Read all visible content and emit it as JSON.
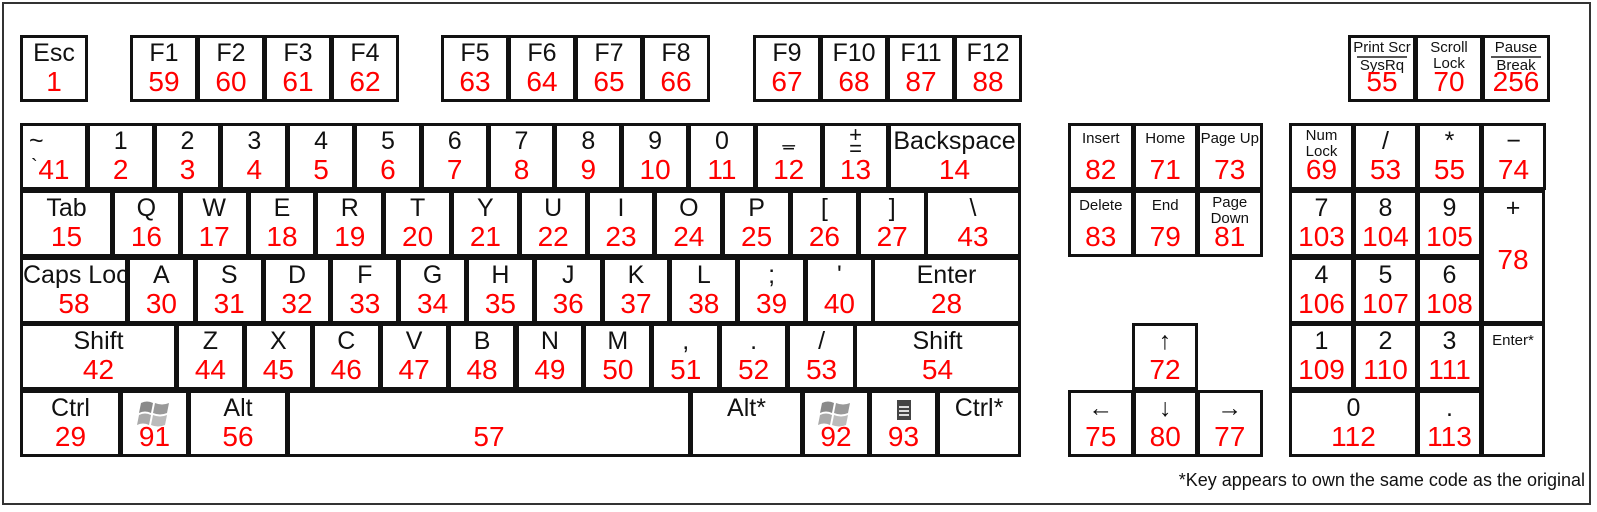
{
  "keys": [
    {
      "id": "esc",
      "label": "Esc",
      "code": "1"
    },
    {
      "id": "f1",
      "label": "F1",
      "code": "59"
    },
    {
      "id": "f2",
      "label": "F2",
      "code": "60"
    },
    {
      "id": "f3",
      "label": "F3",
      "code": "61"
    },
    {
      "id": "f4",
      "label": "F4",
      "code": "62"
    },
    {
      "id": "f5",
      "label": "F5",
      "code": "63"
    },
    {
      "id": "f6",
      "label": "F6",
      "code": "64"
    },
    {
      "id": "f7",
      "label": "F7",
      "code": "65"
    },
    {
      "id": "f8",
      "label": "F8",
      "code": "66"
    },
    {
      "id": "f9",
      "label": "F9",
      "code": "67"
    },
    {
      "id": "f10",
      "label": "F10",
      "code": "68"
    },
    {
      "id": "f11",
      "label": "F11",
      "code": "87"
    },
    {
      "id": "f12",
      "label": "F12",
      "code": "88"
    },
    {
      "id": "printscr",
      "label": "Print Scr",
      "label2": "SysRq",
      "code": "55"
    },
    {
      "id": "scrolllock",
      "label": "Scroll",
      "label2": "Lock",
      "code": "70"
    },
    {
      "id": "pause",
      "label": "Pause",
      "label2": "Break",
      "code": "256"
    },
    {
      "id": "tilde",
      "label": "~",
      "label2": "`",
      "code": "41"
    },
    {
      "id": "1",
      "label": "1",
      "code": "2"
    },
    {
      "id": "2",
      "label": "2",
      "code": "3"
    },
    {
      "id": "3",
      "label": "3",
      "code": "4"
    },
    {
      "id": "4",
      "label": "4",
      "code": "5"
    },
    {
      "id": "5",
      "label": "5",
      "code": "6"
    },
    {
      "id": "6",
      "label": "6",
      "code": "7"
    },
    {
      "id": "7",
      "label": "7",
      "code": "8"
    },
    {
      "id": "8",
      "label": "8",
      "code": "9"
    },
    {
      "id": "9",
      "label": "9",
      "code": "10"
    },
    {
      "id": "0",
      "label": "0",
      "code": "11"
    },
    {
      "id": "minus",
      "label": "_",
      "label2": "−",
      "code": "12"
    },
    {
      "id": "equals",
      "label": "+",
      "label2": "=",
      "code": "13"
    },
    {
      "id": "backspace",
      "label": "Backspace",
      "code": "14"
    },
    {
      "id": "tab",
      "label": "Tab",
      "code": "15"
    },
    {
      "id": "q",
      "label": "Q",
      "code": "16"
    },
    {
      "id": "w",
      "label": "W",
      "code": "17"
    },
    {
      "id": "e",
      "label": "E",
      "code": "18"
    },
    {
      "id": "r",
      "label": "R",
      "code": "19"
    },
    {
      "id": "t",
      "label": "T",
      "code": "20"
    },
    {
      "id": "y",
      "label": "Y",
      "code": "21"
    },
    {
      "id": "u",
      "label": "U",
      "code": "22"
    },
    {
      "id": "i",
      "label": "I",
      "code": "23"
    },
    {
      "id": "o",
      "label": "O",
      "code": "24"
    },
    {
      "id": "p",
      "label": "P",
      "code": "25"
    },
    {
      "id": "lbracket",
      "label": "[",
      "code": "26"
    },
    {
      "id": "rbracket",
      "label": "]",
      "code": "27"
    },
    {
      "id": "backslash",
      "label": "\\",
      "code": "43"
    },
    {
      "id": "capslock",
      "label": "Caps Lock",
      "code": "58"
    },
    {
      "id": "a",
      "label": "A",
      "code": "30"
    },
    {
      "id": "s",
      "label": "S",
      "code": "31"
    },
    {
      "id": "d",
      "label": "D",
      "code": "32"
    },
    {
      "id": "f",
      "label": "F",
      "code": "33"
    },
    {
      "id": "g",
      "label": "G",
      "code": "34"
    },
    {
      "id": "h",
      "label": "H",
      "code": "35"
    },
    {
      "id": "j",
      "label": "J",
      "code": "36"
    },
    {
      "id": "k",
      "label": "K",
      "code": "37"
    },
    {
      "id": "l",
      "label": "L",
      "code": "38"
    },
    {
      "id": "semicolon",
      "label": ";",
      "code": "39"
    },
    {
      "id": "quote",
      "label": "'",
      "code": "40"
    },
    {
      "id": "enter",
      "label": "Enter",
      "code": "28"
    },
    {
      "id": "lshift",
      "label": "Shift",
      "code": "42"
    },
    {
      "id": "z",
      "label": "Z",
      "code": "44"
    },
    {
      "id": "x",
      "label": "X",
      "code": "45"
    },
    {
      "id": "c",
      "label": "C",
      "code": "46"
    },
    {
      "id": "v",
      "label": "V",
      "code": "47"
    },
    {
      "id": "b",
      "label": "B",
      "code": "48"
    },
    {
      "id": "n",
      "label": "N",
      "code": "49"
    },
    {
      "id": "m",
      "label": "M",
      "code": "50"
    },
    {
      "id": "comma",
      "label": ",",
      "code": "51"
    },
    {
      "id": "period",
      "label": ".",
      "code": "52"
    },
    {
      "id": "slash",
      "label": "/",
      "code": "53"
    },
    {
      "id": "rshift",
      "label": "Shift",
      "code": "54"
    },
    {
      "id": "lctrl",
      "label": "Ctrl",
      "code": "29"
    },
    {
      "id": "lwin",
      "icon": "windows-logo-icon",
      "code": "91"
    },
    {
      "id": "lalt",
      "label": "Alt",
      "code": "56"
    },
    {
      "id": "space",
      "code": "57"
    },
    {
      "id": "ralt",
      "label": "Alt*"
    },
    {
      "id": "rwin",
      "icon": "windows-logo-icon",
      "code": "92"
    },
    {
      "id": "menu",
      "icon": "menu-key-icon",
      "code": "93"
    },
    {
      "id": "rctrl",
      "label": "Ctrl*"
    },
    {
      "id": "insert",
      "label": "Insert",
      "code": "82"
    },
    {
      "id": "home",
      "label": "Home",
      "code": "71"
    },
    {
      "id": "pageup",
      "label": "Page Up",
      "code": "73"
    },
    {
      "id": "delete",
      "label": "Delete",
      "code": "83"
    },
    {
      "id": "end",
      "label": "End",
      "code": "79"
    },
    {
      "id": "pagedown",
      "label": "Page",
      "label2": "Down",
      "code": "81"
    },
    {
      "id": "up",
      "label": "↑",
      "code": "72"
    },
    {
      "id": "left",
      "label": "←",
      "code": "75"
    },
    {
      "id": "down",
      "label": "↓",
      "code": "80"
    },
    {
      "id": "right",
      "label": "→",
      "code": "77"
    },
    {
      "id": "numlock",
      "label": "Num",
      "label2": "Lock",
      "code": "69"
    },
    {
      "id": "npdiv",
      "label": "/",
      "code": "53"
    },
    {
      "id": "npmul",
      "label": "*",
      "code": "55"
    },
    {
      "id": "npsub",
      "label": "−",
      "code": "74"
    },
    {
      "id": "np7",
      "label": "7",
      "code": "103"
    },
    {
      "id": "np8",
      "label": "8",
      "code": "104"
    },
    {
      "id": "np9",
      "label": "9",
      "code": "105"
    },
    {
      "id": "npadd",
      "label": "+",
      "code": "78"
    },
    {
      "id": "np4",
      "label": "4",
      "code": "106"
    },
    {
      "id": "np5",
      "label": "5",
      "code": "107"
    },
    {
      "id": "np6",
      "label": "6",
      "code": "108"
    },
    {
      "id": "np1",
      "label": "1",
      "code": "109"
    },
    {
      "id": "np2",
      "label": "2",
      "code": "110"
    },
    {
      "id": "np3",
      "label": "3",
      "code": "111"
    },
    {
      "id": "npenter",
      "label": "Enter*"
    },
    {
      "id": "np0",
      "label": "0",
      "code": "112"
    },
    {
      "id": "npdot",
      "label": ".",
      "code": "113"
    }
  ],
  "footnote": "*Key appears to own the same code as the original",
  "colors": {
    "code": "#ff0000",
    "label": "#111111",
    "border": "#111111"
  }
}
